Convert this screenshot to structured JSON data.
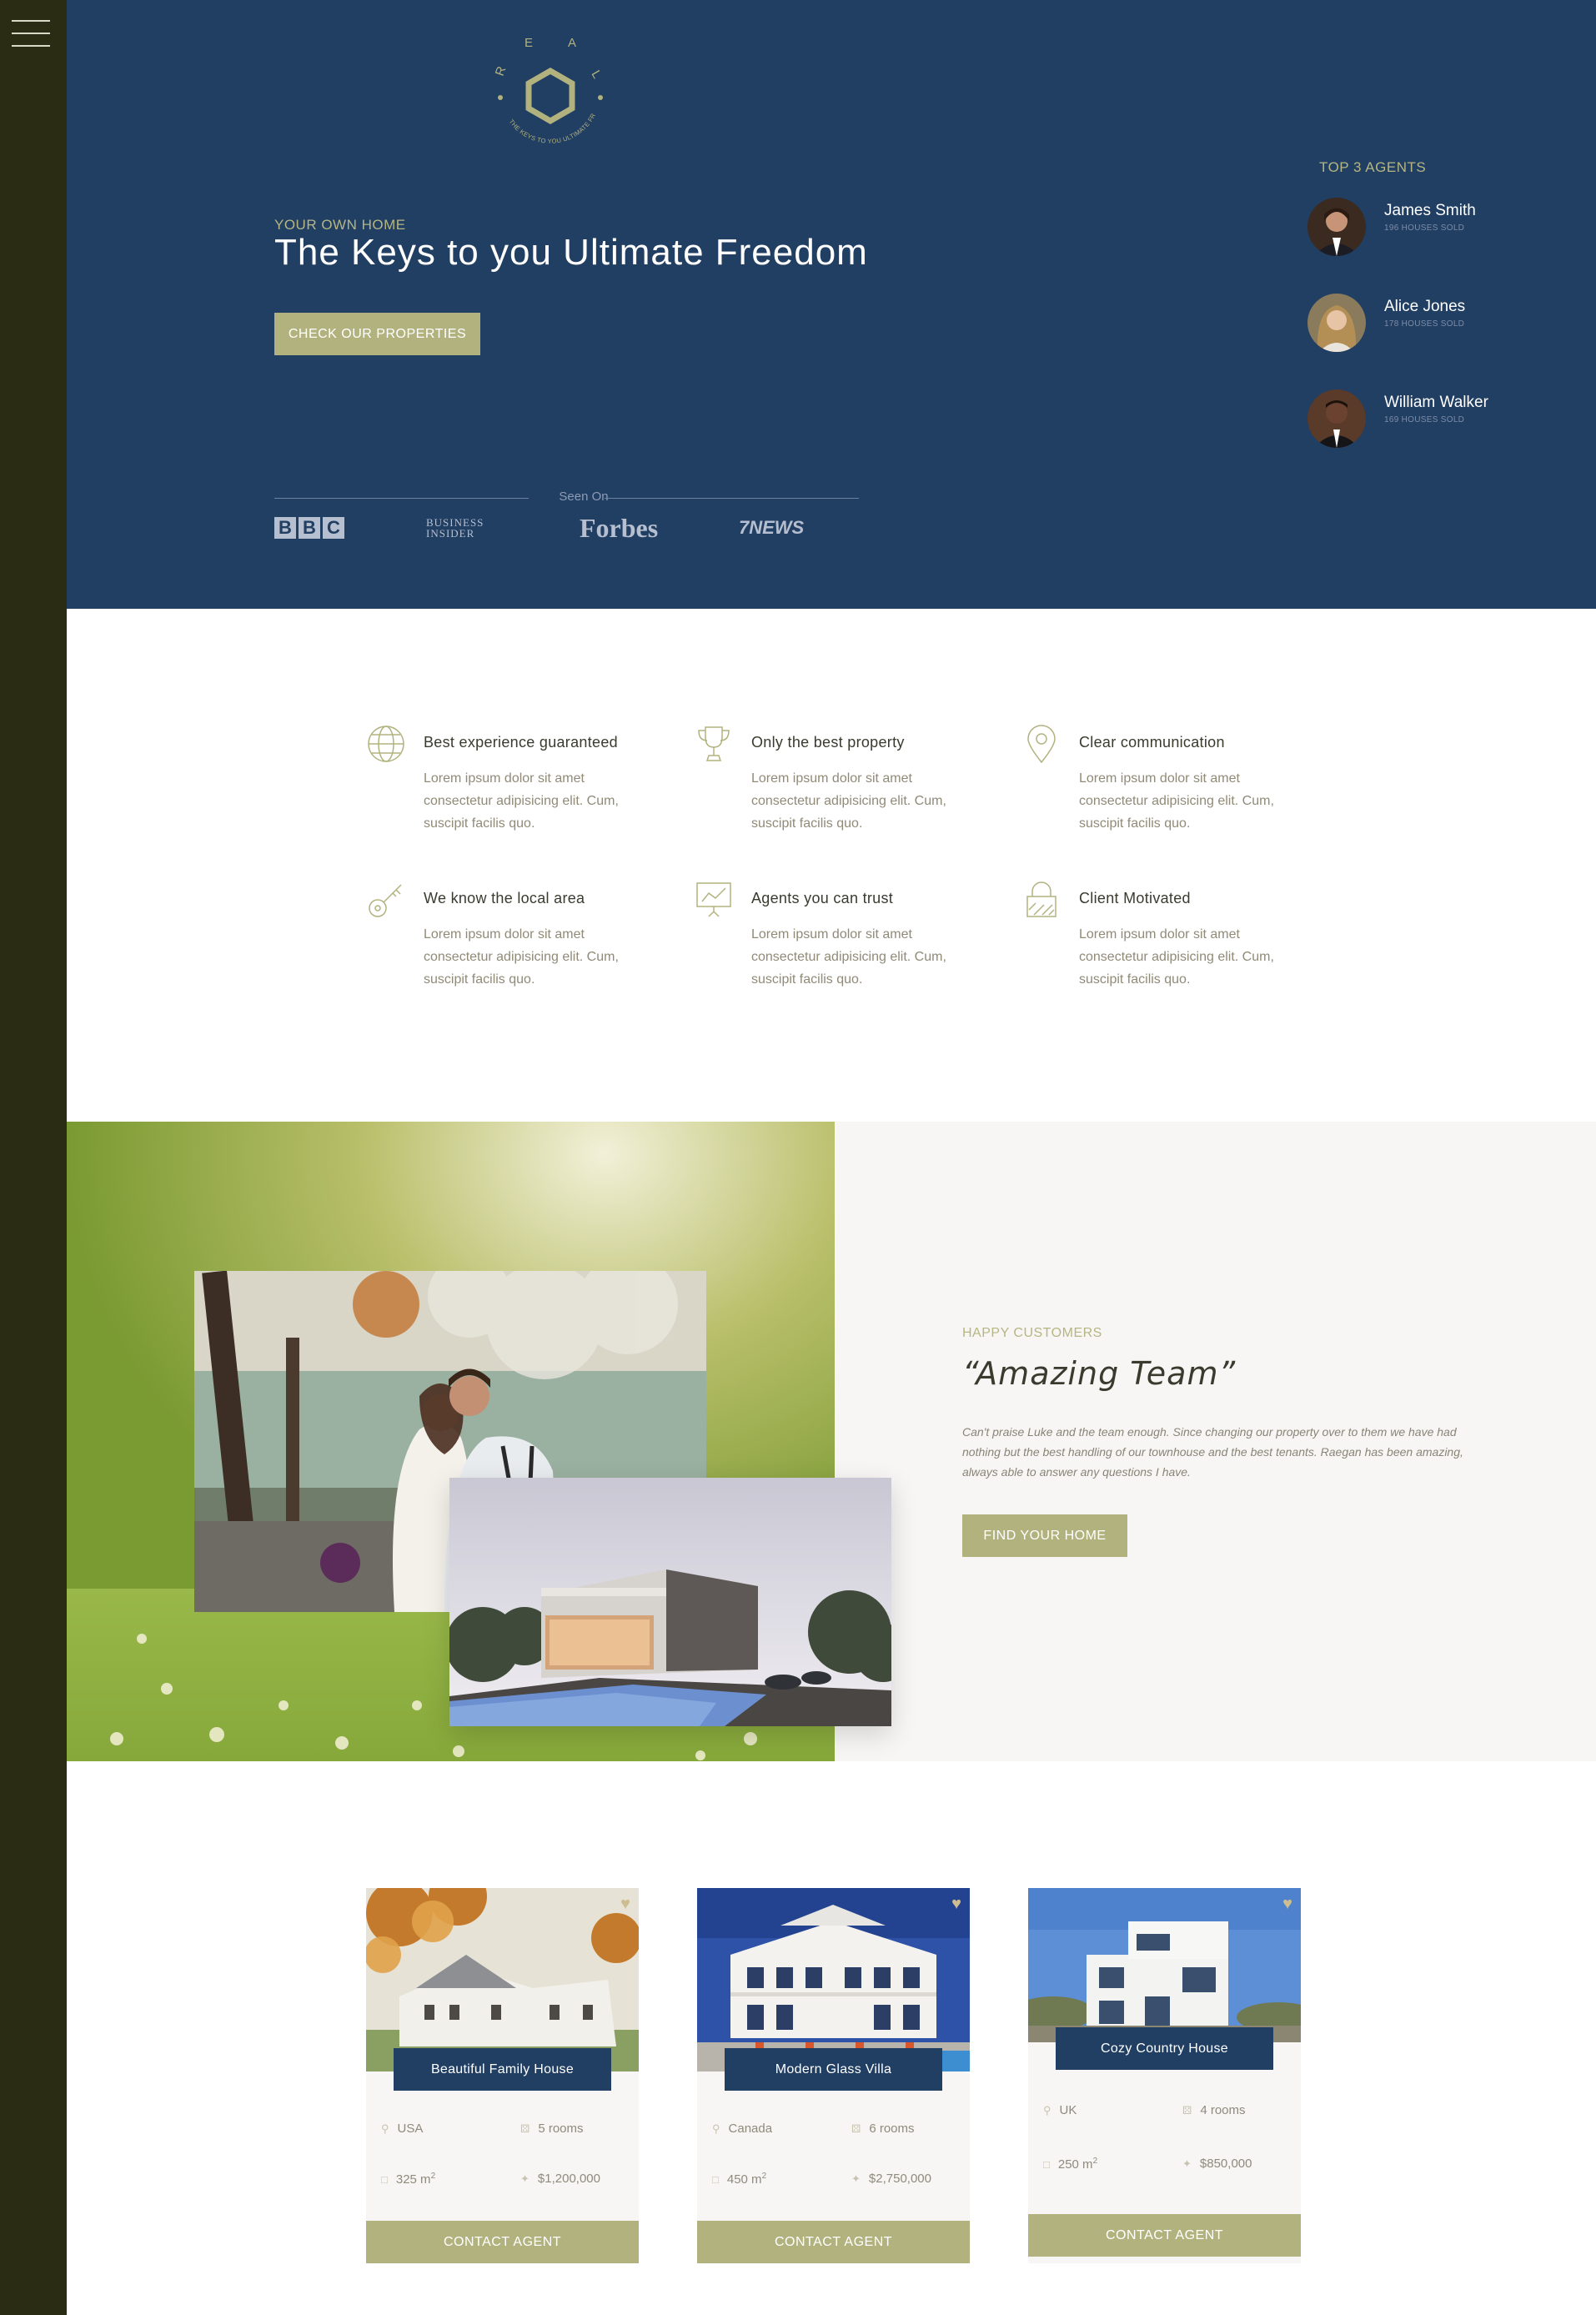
{
  "hero": {
    "logo_letters": "R E A L",
    "logo_tagline": "THE KEYS TO YOU ULTIMATE FREEDOM",
    "kicker": "YOUR OWN HOME",
    "title": "The Keys to you Ultimate Freedom",
    "cta": "CHECK OUR PROPERTIES",
    "seen_on": "Seen On",
    "press": {
      "bbc": [
        "B",
        "B",
        "C"
      ],
      "bi_line1": "BUSINESS",
      "bi_line2": "INSIDER",
      "forbes": "Forbes",
      "news": "7NEWS"
    }
  },
  "agents": {
    "title": "TOP 3 AGENTS",
    "items": [
      {
        "name": "James Smith",
        "sold": "196 HOUSES SOLD"
      },
      {
        "name": "Alice Jones",
        "sold": "178 HOUSES SOLD"
      },
      {
        "name": "William Walker",
        "sold": "169 HOUSES SOLD"
      }
    ]
  },
  "features": [
    {
      "icon": "globe-icon",
      "title": "Best experience guaranteed",
      "text": "Lorem ipsum dolor sit amet consectetur adipisicing elit. Cum, suscipit facilis quo."
    },
    {
      "icon": "trophy-icon",
      "title": "Only the best property",
      "text": "Lorem ipsum dolor sit amet consectetur adipisicing elit. Cum, suscipit facilis quo."
    },
    {
      "icon": "map-pin-icon",
      "title": "Clear communication",
      "text": "Lorem ipsum dolor sit amet consectetur adipisicing elit. Cum, suscipit facilis quo."
    },
    {
      "icon": "key-icon",
      "title": "We know the local area",
      "text": "Lorem ipsum dolor sit amet consectetur adipisicing elit. Cum, suscipit facilis quo."
    },
    {
      "icon": "presentation-chart-icon",
      "title": "Agents you can trust",
      "text": "Lorem ipsum dolor sit amet consectetur adipisicing elit. Cum, suscipit facilis quo."
    },
    {
      "icon": "lock-icon",
      "title": "Client Motivated",
      "text": "Lorem ipsum dolor sit amet consectetur adipisicing elit. Cum, suscipit facilis quo."
    }
  ],
  "testimonial": {
    "kicker": "HAPPY CUSTOMERS",
    "title": "“Amazing Team”",
    "text": "Can't praise Luke and the team enough. Since changing our property over to them we have had nothing but the best handling of our townhouse and the best tenants. Raegan has been amazing, always able to answer any questions I have.",
    "cta": "FIND YOUR HOME"
  },
  "properties": [
    {
      "name": "Beautiful Family House",
      "country": "USA",
      "rooms": "5 rooms",
      "area": "325 m",
      "price": "$1,200,000",
      "cta": "CONTACT AGENT"
    },
    {
      "name": "Modern Glass Villa",
      "country": "Canada",
      "rooms": "6 rooms",
      "area": "450 m",
      "price": "$2,750,000",
      "cta": "CONTACT AGENT"
    },
    {
      "name": "Cozy Country House",
      "country": "UK",
      "rooms": "4 rooms",
      "area": "250 m",
      "price": "$850,000",
      "cta": "CONTACT AGENT"
    }
  ],
  "area_unit_sup": "2",
  "colors": {
    "navy": "#213e63",
    "gold": "#b2b27f",
    "sidebar": "#2a2c14",
    "light_bg": "#f7f6f4"
  }
}
